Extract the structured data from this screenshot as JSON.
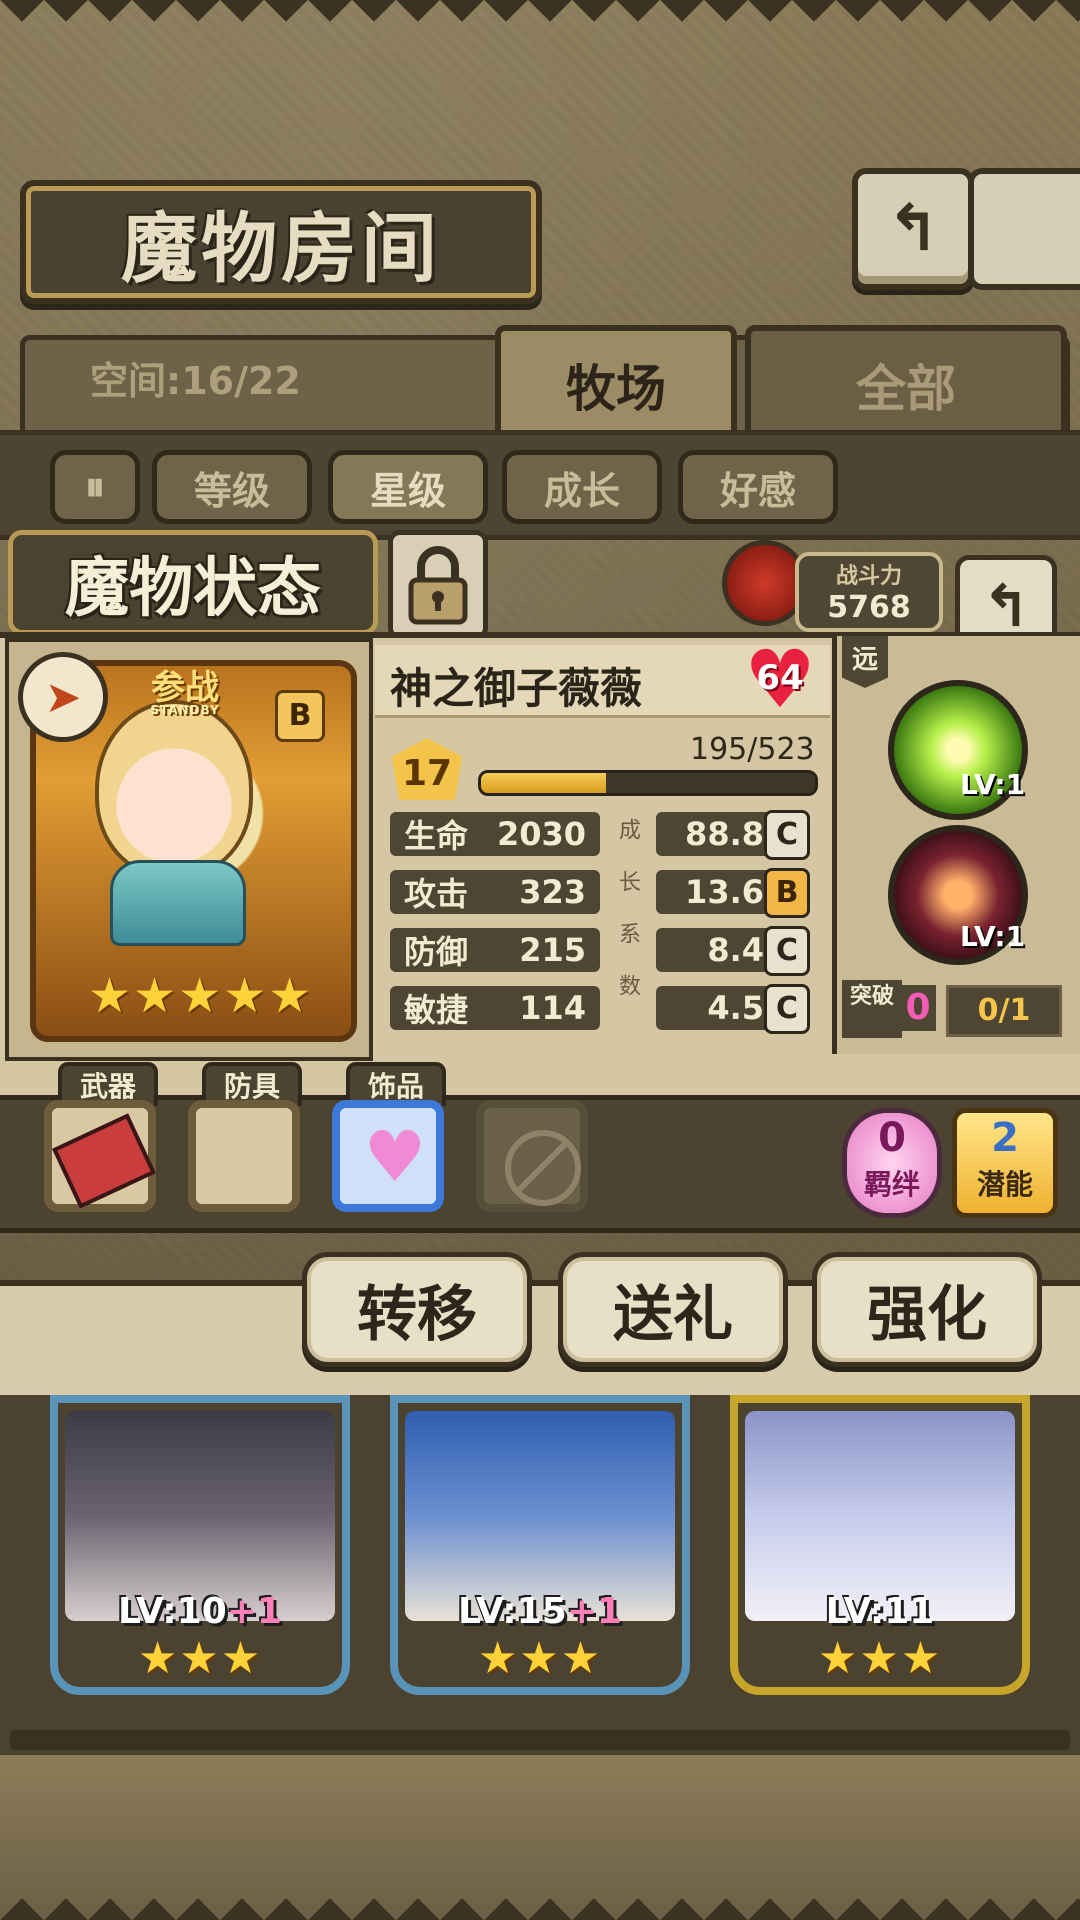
{
  "header": {
    "title": "魔物房间",
    "back_icon": "return-icon"
  },
  "tabs": {
    "space_label": "空间:16/22",
    "items": [
      {
        "label": "牧场",
        "active": true
      },
      {
        "label": "全部",
        "active": false
      }
    ]
  },
  "sort": {
    "toggle_icon": "pause-toggle-icon",
    "buttons": [
      {
        "label": "等级",
        "selected": false
      },
      {
        "label": "星级",
        "selected": true
      },
      {
        "label": "成长",
        "selected": false
      },
      {
        "label": "好感",
        "selected": false
      }
    ]
  },
  "status": {
    "title": "魔物状态",
    "power_label": "战斗力",
    "power_value": "5768"
  },
  "monster": {
    "name": "神之御子薇薇",
    "affection": "64",
    "standby_main": "参战",
    "standby_sub": "STANDBY",
    "rank": "B",
    "stars": "★★★★★",
    "level": "17",
    "exp_text": "195/523",
    "exp_fraction": 0.373,
    "range": "远",
    "growth_vertical": "成长系数",
    "stats": [
      {
        "label": "生命",
        "value": "2030",
        "growth": "88.8",
        "grade": "C"
      },
      {
        "label": "攻击",
        "value": "323",
        "growth": "13.6",
        "grade": "B"
      },
      {
        "label": "防御",
        "value": "215",
        "growth": "8.4",
        "grade": "C"
      },
      {
        "label": "敏捷",
        "value": "114",
        "growth": "4.5",
        "grade": "C"
      }
    ],
    "skills": [
      {
        "lv": "LV:1",
        "icon": "light-burst-skill-icon",
        "color": "#9be04a"
      },
      {
        "lv": "LV:1",
        "icon": "fist-strike-skill-icon",
        "color": "#5a1f2a"
      }
    ],
    "breakthrough_label": "突破",
    "breakthrough_count": "0",
    "breakthrough_progress": "0/1"
  },
  "equipment": {
    "labels": [
      "武器",
      "防具",
      "饰品"
    ],
    "bond_count": "0",
    "bond_label": "羁绊",
    "potential_count": "2",
    "potential_label": "潜能"
  },
  "actions": [
    {
      "label": "转移"
    },
    {
      "label": "送礼"
    },
    {
      "label": "强化"
    }
  ],
  "roster": [
    {
      "lv": "LV:10",
      "plus": "+1",
      "stars": "★★★"
    },
    {
      "lv": "LV:15",
      "plus": "+1",
      "stars": "★★★"
    },
    {
      "lv": "LV:11",
      "plus": "",
      "stars": "★★★"
    }
  ]
}
